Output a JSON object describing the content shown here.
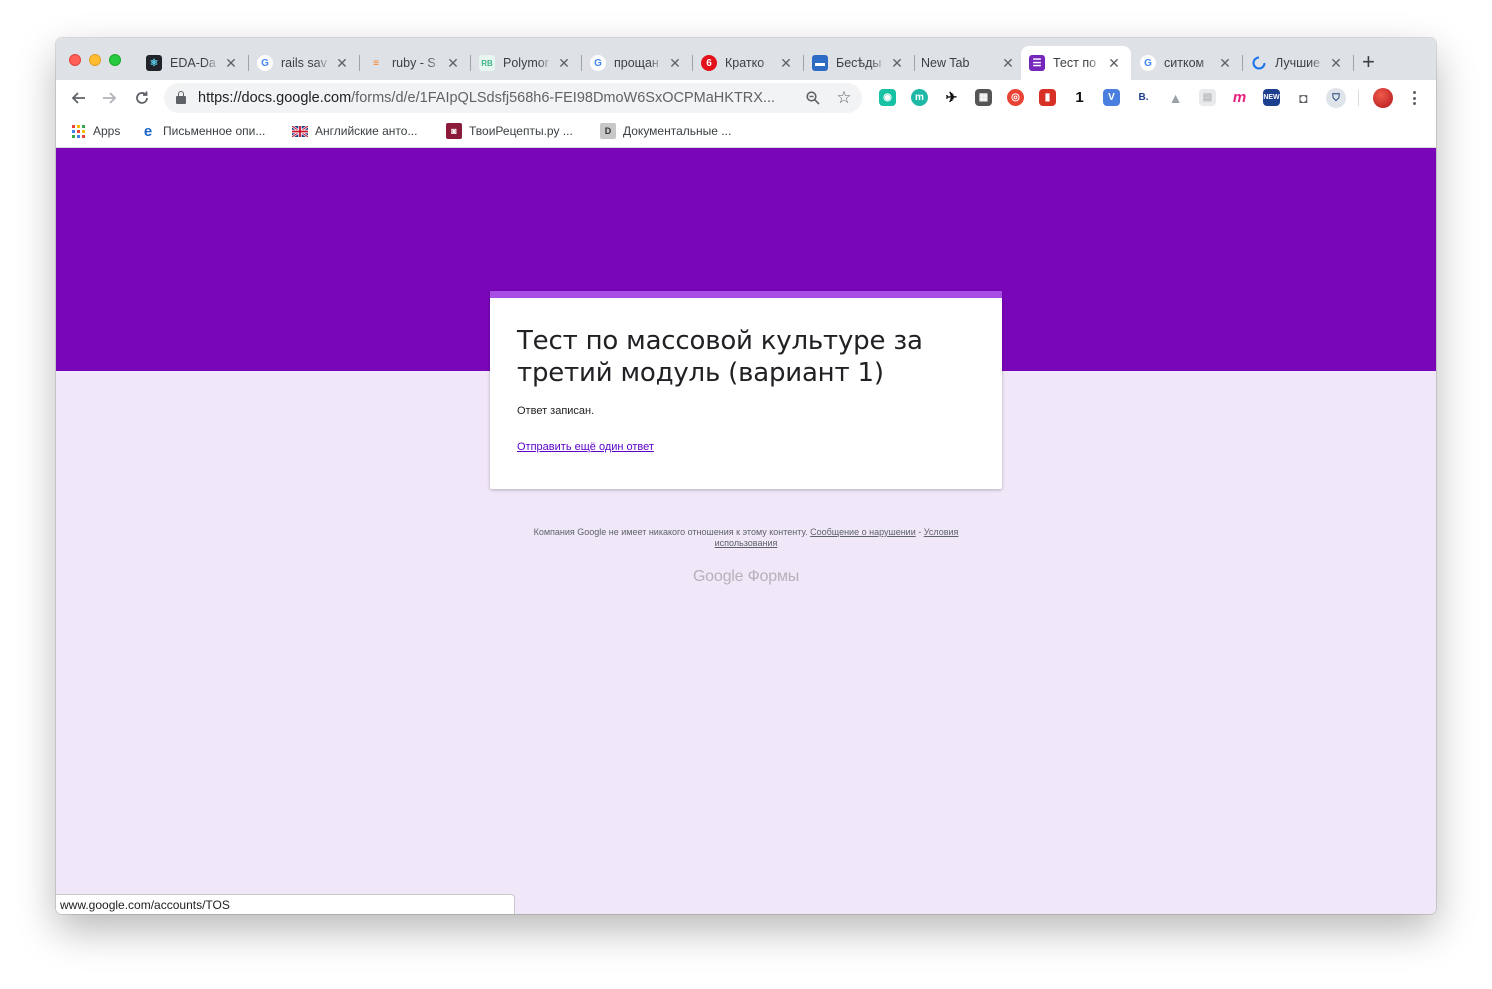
{
  "window": {
    "tabs": [
      {
        "title": "EDA-Da",
        "favicon": "react-icon",
        "color": "#61dafb"
      },
      {
        "title": "rails sav",
        "favicon": "google-icon",
        "color": "#4285f4"
      },
      {
        "title": "ruby - S",
        "favicon": "stackoverflow-icon",
        "color": "#f48024"
      },
      {
        "title": "Polymor",
        "favicon": "rb-icon",
        "color": "#3fb68b"
      },
      {
        "title": "прощан",
        "favicon": "google-icon",
        "color": "#4285f4"
      },
      {
        "title": "Кратко",
        "favicon": "six-icon",
        "color": "#e3111a"
      },
      {
        "title": "Бесѣды",
        "favicon": "chat-icon",
        "color": "#2d6bc4"
      },
      {
        "title": "New Tab",
        "favicon": "",
        "color": ""
      },
      {
        "title": "Тест по",
        "favicon": "forms-icon",
        "color": "#7627bb"
      },
      {
        "title": "ситком",
        "favicon": "google-icon",
        "color": "#4285f4"
      },
      {
        "title": "Лучшие",
        "favicon": "loading-icon",
        "color": "#1a73e8"
      }
    ],
    "active_tab": 8
  },
  "toolbar": {
    "url_host": "https://docs.google.com",
    "url_path": "/forms/d/e/1FAIpQLSdsfj568h6-FEI98DmoW6SxOCPMaHKTRX..."
  },
  "bookmarks": [
    {
      "label": "Apps",
      "icon": "apps-grid-icon"
    },
    {
      "label": "Письменное опи...",
      "icon": "e-icon"
    },
    {
      "label": "Английские анто...",
      "icon": "uk-flag-icon"
    },
    {
      "label": "ТвоиРецепты.ру ...",
      "icon": "recipe-icon"
    },
    {
      "label": "Документальные ...",
      "icon": "doc-icon"
    }
  ],
  "form": {
    "title": "Тест по массовой культуре за третий модуль (вариант 1)",
    "confirmation": "Ответ записан.",
    "another_response": "Отправить ещё один ответ"
  },
  "footer": {
    "disclaimer": "Компания Google не имеет никакого отношения к этому контенту.",
    "report_abuse": "Сообщение о нарушении",
    "separator": " - ",
    "terms": "Условия использования",
    "brand": "Google Формы"
  },
  "status_bar": "www.google.com/accounts/TOS",
  "colors": {
    "banner": "#7a06b9",
    "background": "#f0e7f8",
    "card_accent": "#a94ee4",
    "link": "#5b00c8"
  }
}
